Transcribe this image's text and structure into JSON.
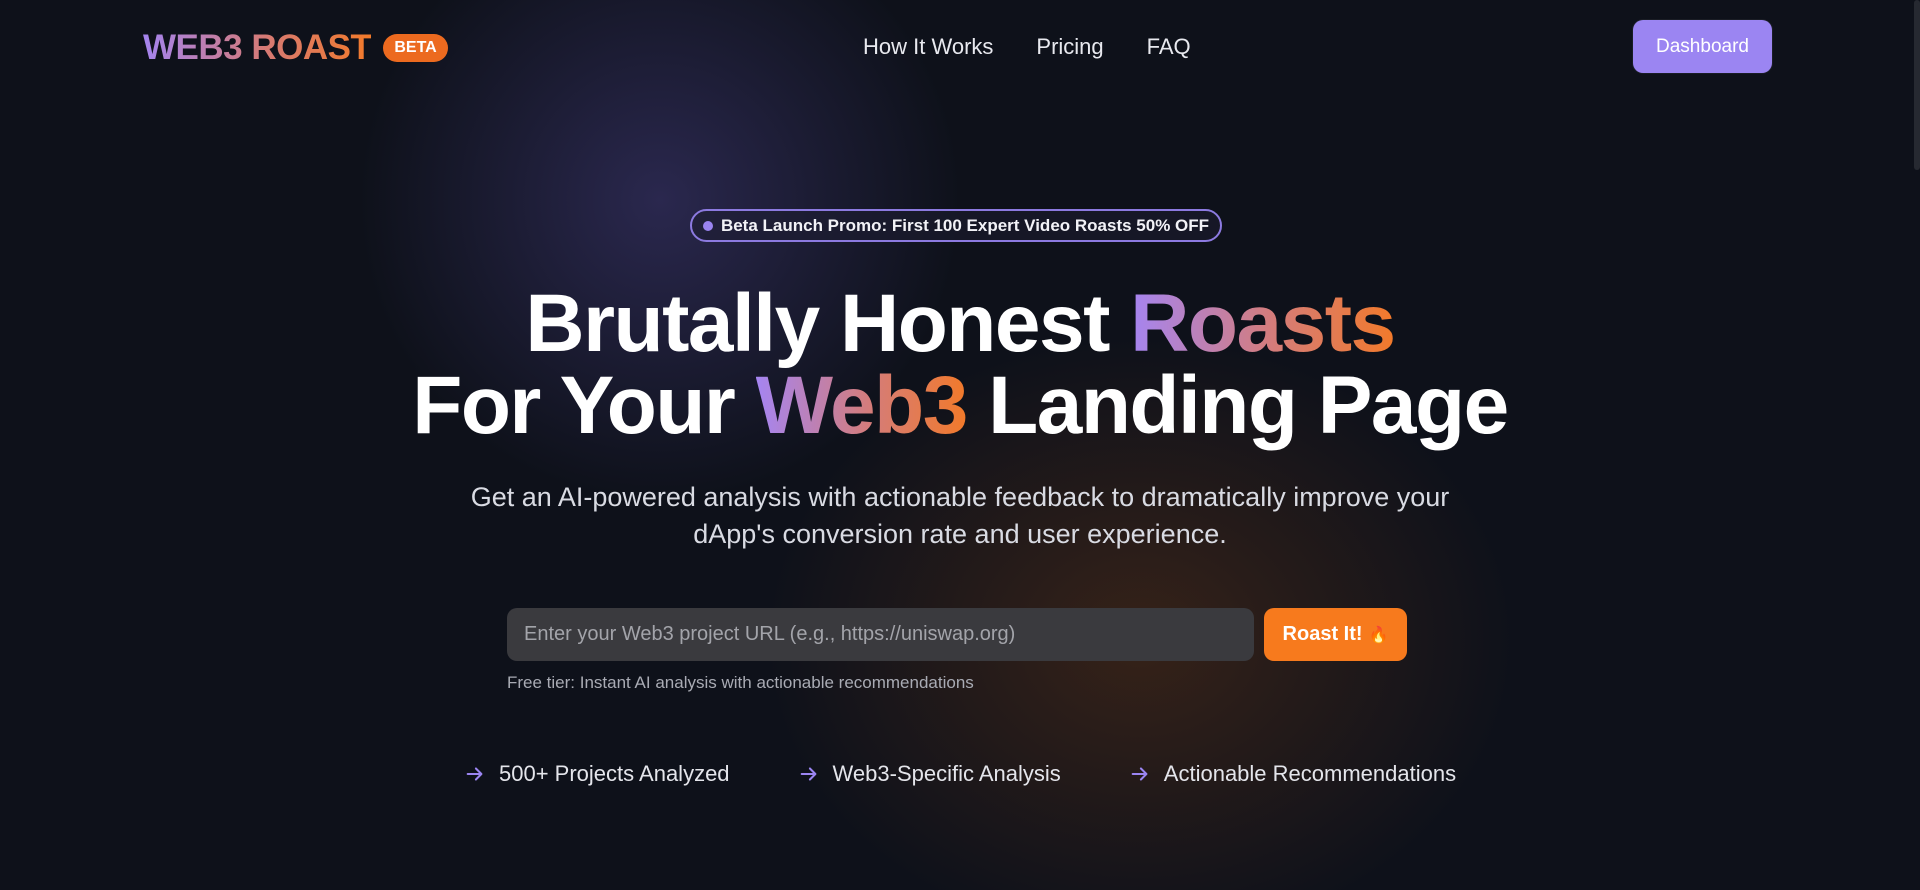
{
  "header": {
    "logo_text": "WEB3 ROAST",
    "badge": "BETA",
    "nav": [
      "How It Works",
      "Pricing",
      "FAQ"
    ],
    "dashboard_label": "Dashboard"
  },
  "promo": {
    "text": "Beta Launch Promo: First 100 Expert Video Roasts 50% OFF"
  },
  "hero": {
    "headline_line1_plain": "Brutally Honest ",
    "headline_line1_accent": "Roasts",
    "headline_line2_plain_a": "For Your ",
    "headline_line2_accent": "Web3",
    "headline_line2_plain_b": " Landing Page",
    "subtitle": "Get an AI-powered analysis with actionable feedback to dramatically improve your dApp's conversion rate and user experience."
  },
  "search": {
    "value": "",
    "placeholder": "Enter your Web3 project URL (e.g., https://uniswap.org)",
    "button_label": "Roast It!",
    "button_icon": "fire-icon",
    "note": "Free tier: Instant AI analysis with actionable recommendations"
  },
  "features": [
    {
      "label": "500+ Projects Analyzed",
      "icon": "arrow-right-icon"
    },
    {
      "label": "Web3-Specific Analysis",
      "icon": "arrow-right-icon"
    },
    {
      "label": "Actionable Recommendations",
      "icon": "arrow-right-icon"
    }
  ],
  "colors": {
    "background": "#0e111a",
    "accent_purple": "#9b85f2",
    "accent_orange": "#f77a1d",
    "input_bg": "#3a3a3e"
  }
}
